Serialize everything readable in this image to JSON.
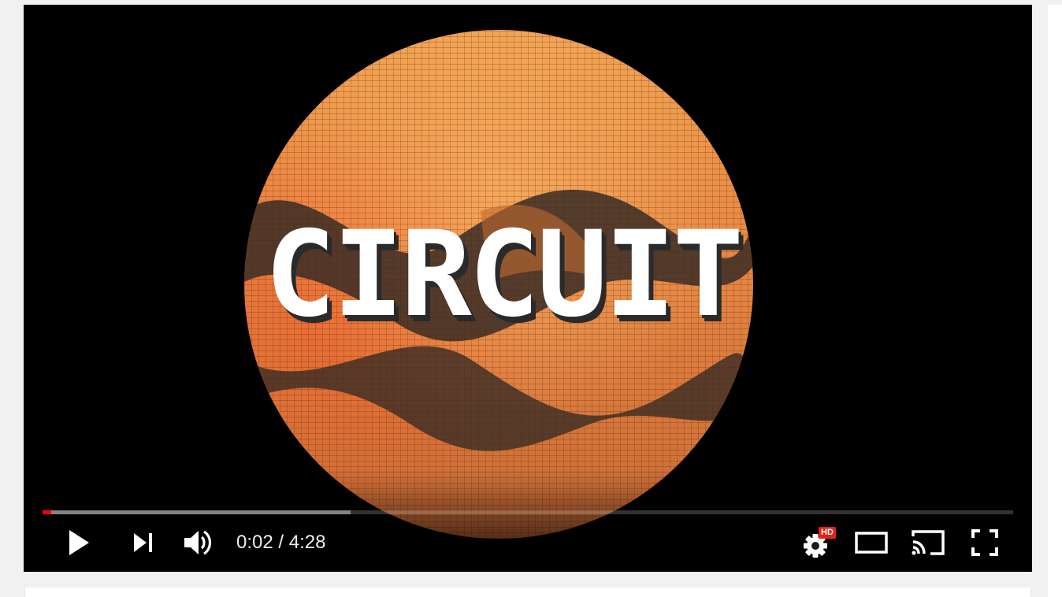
{
  "player": {
    "title_text": "CIRCUIT",
    "time": {
      "current": "0:02",
      "separator": " / ",
      "duration": "4:28"
    },
    "progress": {
      "played_fraction": 0.009,
      "buffered_fraction": 0.317
    },
    "badges": {
      "hd": "HD"
    },
    "controls": [
      {
        "icon": "play-icon"
      },
      {
        "icon": "next-icon"
      },
      {
        "icon": "volume-icon"
      },
      {
        "icon": "settings-icon"
      },
      {
        "icon": "theater-mode-icon"
      },
      {
        "icon": "cast-icon"
      },
      {
        "icon": "fullscreen-icon"
      }
    ],
    "colors": {
      "progress_played": "#ff0000",
      "hd_badge": "#e62117",
      "art_orange": "#e98a45"
    }
  }
}
